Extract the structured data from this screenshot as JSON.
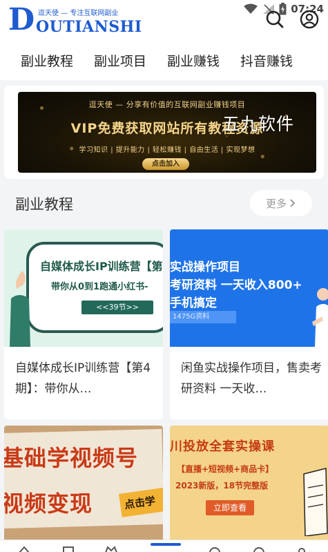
{
  "app": {
    "logo_slogan": "逗天使 — 专注互联网副业",
    "logo_letter": "D",
    "logo_text": "OUTIANSHI",
    "brand_color": "#1e5bd0"
  },
  "status_bar": {
    "time": "07:24",
    "icons": [
      "wifi-icon",
      "no-signal-icon",
      "battery-icon"
    ]
  },
  "header": {
    "icons": [
      "search-icon",
      "user-icon"
    ]
  },
  "categories": [
    "副业教程",
    "副业项目",
    "副业赚钱",
    "抖音赚钱"
  ],
  "banner": {
    "top_text": "逗天使 — 分享有价值的互联网副业赚钱项目",
    "main_text": "VIP免费获取网站所有教程资源",
    "sub_text": "学习知识 | 提升能力 | 轻松赚钱 | 自由生活 | 实现梦想",
    "button_label": "点击加入"
  },
  "watermark": "五九软件",
  "section": {
    "title": "副业教程",
    "more_label": "更多"
  },
  "courses": [
    {
      "title": "自媒体成长IP训练营【第4期】：带你从…",
      "thumb_line1": "自媒体成长IP训练营【第",
      "thumb_line2": "带你从0到1跑通小红书-",
      "thumb_pill": "<<39节>>"
    },
    {
      "title": "闲鱼实战操作项目，售卖考研资料 一天收…",
      "thumb_line1": "实战操作项目",
      "thumb_line2": "考研资料 一天收入800+",
      "thumb_line3": "手机搞定",
      "thumb_tag": "1475G资料"
    },
    {
      "title": "",
      "thumb_line1": "基础学视频号",
      "thumb_line2": "视频变现",
      "thumb_stamp": "点击学"
    },
    {
      "title": "",
      "thumb_line1": "川投放全套实操课",
      "thumb_line2": "【直播+短视频+商品卡】",
      "thumb_line3": "2023新版，18节完整版",
      "thumb_button": "立即查看"
    }
  ]
}
